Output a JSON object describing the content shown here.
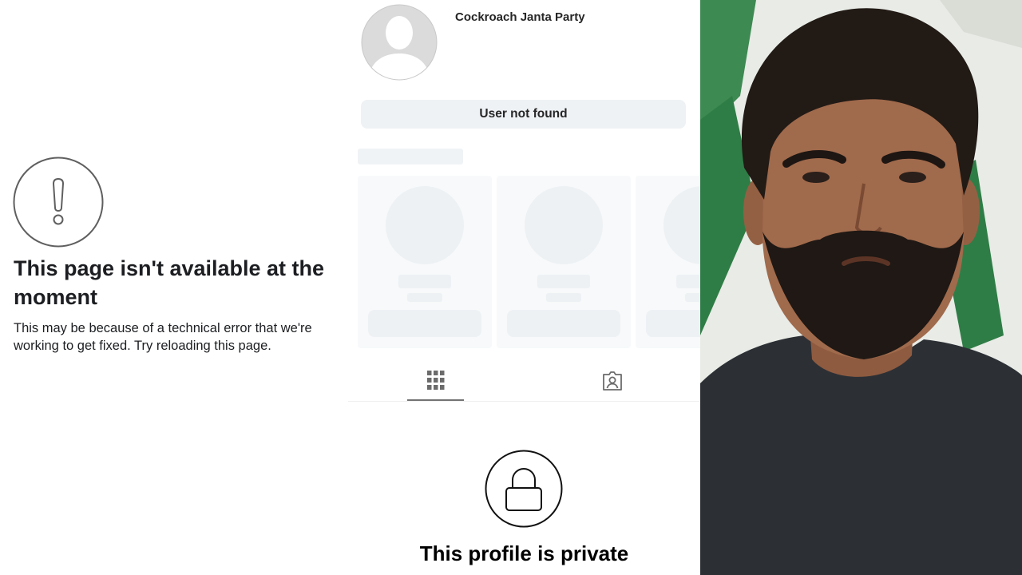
{
  "error_page": {
    "title": "This page isn't available at the moment",
    "description": "This may be because of a technical error that we're working to get fixed. Try reloading this page."
  },
  "profile": {
    "username": "Cockroach Janta Party",
    "status_button": "User not found",
    "private_message": "This profile is private",
    "tabs": [
      {
        "icon": "grid-icon",
        "active": true
      },
      {
        "icon": "tagged-icon",
        "active": false
      }
    ],
    "suggestion_cards_count": 3
  },
  "photo": {
    "subject": "bearded-man-portrait",
    "colors": {
      "background_green": "#2f7d46",
      "shirt": "#2c3035",
      "hair": "#221a15",
      "skin": "#a06a4c"
    }
  },
  "colors": {
    "text_primary": "#1c1e21",
    "button_bg": "#eff2f5",
    "skeleton": "#eef1f4",
    "icon_gray": "#6b6b6b"
  }
}
